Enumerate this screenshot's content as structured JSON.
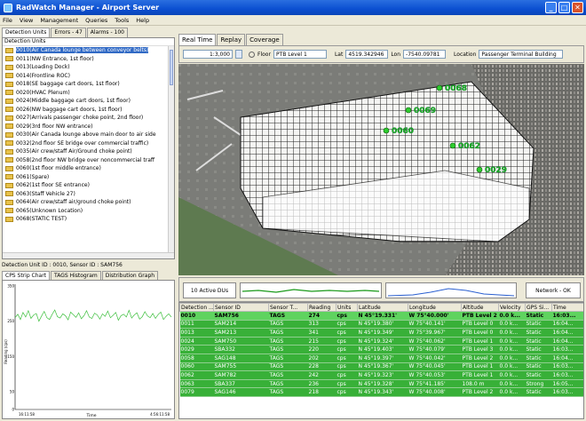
{
  "window": {
    "title": "RadWatch Manager - Airport Server"
  },
  "menu": [
    "File",
    "View",
    "Management",
    "Queries",
    "Tools",
    "Help"
  ],
  "left_tabs": [
    "Detection Units",
    "Errors - 47",
    "Alarms - 100"
  ],
  "units": {
    "header": "Detection Units",
    "items": [
      "0010(Air Canada lounge between conveyor belts)",
      "0011(NW Entrance, 1st floor)",
      "0013(Loading Dock)",
      "0014(Frontline ROC)",
      "0018(SE baggage cart doors, 1st floor)",
      "0020(HVAC Plenum)",
      "0024(Middle baggage cart doors, 1st floor)",
      "0026(NW baggage cart doors, 1st floor)",
      "0027(Arrivals passenger choke point, 2nd floor)",
      "0029(3rd floor NW entrance)",
      "0030(Air Canada lounge above main door to air side",
      "0032(2nd floor SE bridge over commercial traffic)",
      "0035(Air crew/staff Air/Ground choke point)",
      "0058(2nd floor NW bridge over noncommercial traff",
      "0060(1st floor middle entrance)",
      "0061(Spare)",
      "0062(1st floor SE entrance)",
      "0063(Staff Vehicle 27)",
      "0064(Air crew/staff air/ground choke point)",
      "0065(Unknown Location)",
      "0068(STATIC TEST)"
    ]
  },
  "detector_label": "Detection Unit ID : 0010, Sensor ID : SAM756",
  "chart_tabs": [
    "CPS Strip Chart",
    "TAGS Histogram",
    "Distribution Graph"
  ],
  "chart_data": {
    "type": "line",
    "ylabel": "Reading (cps)",
    "xlabel": "Time",
    "x_tick_labels": [
      "16:11:58",
      "4:56:11:58"
    ],
    "y_tick_labels": [
      "350",
      "250",
      "150",
      "50",
      "0"
    ],
    "ylim": [
      0,
      350
    ],
    "series": [
      {
        "values": [
          260,
          270,
          255,
          275,
          262,
          280,
          258,
          268,
          272,
          250,
          265,
          278,
          260,
          255,
          270,
          282,
          263,
          259,
          271,
          266,
          254,
          276,
          269,
          261,
          274,
          257,
          266,
          280,
          262,
          258,
          273,
          268,
          256,
          271,
          264,
          279,
          260,
          267,
          275,
          253,
          266,
          270,
          262,
          281,
          259,
          268,
          274,
          256,
          263,
          277,
          265,
          260,
          272,
          258,
          269,
          276,
          255,
          264,
          271,
          262
        ]
      }
    ]
  },
  "right_tabs": [
    "Real Time",
    "Replay",
    "Coverage"
  ],
  "map_controls": {
    "scale": "1:3,000",
    "floor_label": "Floor",
    "floor_value": "PTB Level 1",
    "lat_label": "Lat",
    "lat_value": "4519.342946",
    "lon_label": "Lon",
    "lon_value": "-7540.09781",
    "location_label": "Location",
    "location_value": "Passenger Terminal Building"
  },
  "map_markers": [
    "0068",
    "0069",
    "0060",
    "0062",
    "0029"
  ],
  "status": {
    "active": "10 Active DUs",
    "network": "Network - OK"
  },
  "grid": {
    "columns": [
      "Detection ...",
      "Sensor ID",
      "Sensor T...",
      "Reading",
      "Units",
      "Latitude",
      "Longitude",
      "Altitude",
      "Velocity",
      "GPS Si...",
      "Time"
    ],
    "rows": [
      [
        "0010",
        "SAM756",
        "TAGS",
        "274",
        "cps",
        "N 45°19.331'",
        "W 75°40.000'",
        "PTB Level 2",
        "0.0 k...",
        "Static",
        "16:03..."
      ],
      [
        "0011",
        "SAM214",
        "TAGS",
        "313",
        "cps",
        "N 45°19.380'",
        "W 75°40.141'",
        "PTB Level 0",
        "0.0 k...",
        "Static",
        "16:04..."
      ],
      [
        "0013",
        "SAM213",
        "TAGS",
        "341",
        "cps",
        "N 45°19.349'",
        "W 75°39.967'",
        "PTB Level 0",
        "0.0 k...",
        "Static",
        "16:04..."
      ],
      [
        "0024",
        "SAM750",
        "TAGS",
        "215",
        "cps",
        "N 45°19.324'",
        "W 75°40.062'",
        "PTB Level 1",
        "0.0 k...",
        "Static",
        "16:04..."
      ],
      [
        "0029",
        "SBA332",
        "TAGS",
        "220",
        "cps",
        "N 45°19.403'",
        "W 75°40.079'",
        "PTB Level 3",
        "0.0 k...",
        "Static",
        "16:03..."
      ],
      [
        "0058",
        "SAG148",
        "TAGS",
        "202",
        "cps",
        "N 45°19.397'",
        "W 75°40.042'",
        "PTB Level 2",
        "0.0 k...",
        "Static",
        "16:04..."
      ],
      [
        "0060",
        "SAM755",
        "TAGS",
        "228",
        "cps",
        "N 45°19.367'",
        "W 75°40.045'",
        "PTB Level 1",
        "0.0 k...",
        "Static",
        "16:03..."
      ],
      [
        "0062",
        "SAM782",
        "TAGS",
        "242",
        "cps",
        "N 45°19.323'",
        "W 75°40.053'",
        "PTB Level 1",
        "0.0 k...",
        "Static",
        "16:03..."
      ],
      [
        "0063",
        "SBA337",
        "TAGS",
        "236",
        "cps",
        "N 45°19.328'",
        "W 75°41.185'",
        "108.0 m",
        "0.0 k...",
        "Strong",
        "16:05..."
      ],
      [
        "0079",
        "SAG146",
        "TAGS",
        "218",
        "cps",
        "N 45°19.343'",
        "W 75°40.008'",
        "PTB Level 2",
        "0.0 k...",
        "Static",
        "16:03..."
      ]
    ]
  },
  "colors": {
    "titlebar": "#0b4fd1",
    "grid_row": "#38b038",
    "selected": "#316ac5",
    "marker": "#2ecc2e"
  }
}
